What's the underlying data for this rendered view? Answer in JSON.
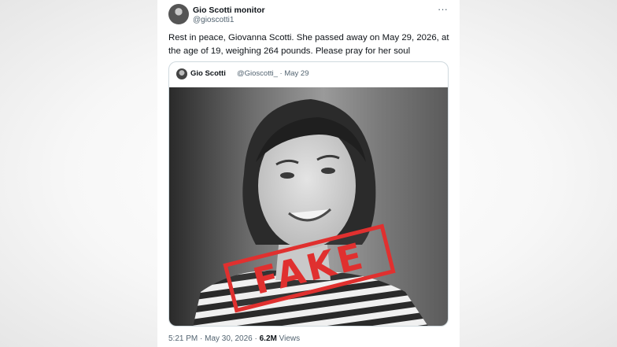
{
  "author": {
    "display_name": "Gio Scotti monitor",
    "handle": "@gioscotti1"
  },
  "tweet": {
    "text": "Rest in peace, Giovanna Scotti. She passed away on May 29, 2026, at the age of 19, weighing 264 pounds. Please pray for her soul"
  },
  "quoted_tweet": {
    "display_name": "Gio Scotti",
    "handle_date": "@Gioscotti_ · May 29",
    "image_stamp": "FAKE"
  },
  "meta": {
    "time_date": "5:21 PM · May 30, 2026 · ",
    "views_count": "6.2M",
    "views_label": " Views"
  },
  "icons": {
    "more": "more-horizontal-icon"
  },
  "colors": {
    "stamp": "#e0302f",
    "text_primary": "#0f1419",
    "text_secondary": "#536471",
    "border": "#cfd9de"
  }
}
